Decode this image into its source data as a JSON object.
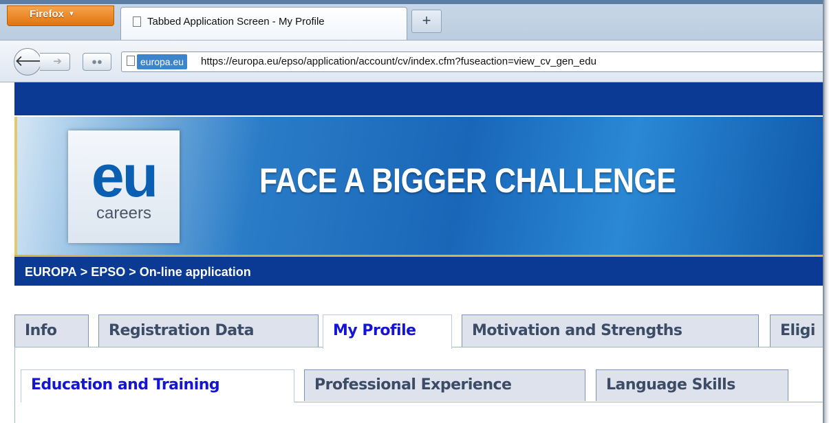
{
  "browser": {
    "menu_label": "Firefox",
    "tab_title": "Tabbed Application Screen - My Profile",
    "new_tab_label": "+",
    "site_badge": "europa.eu",
    "url": "https://europa.eu/epso/application/account/cv/index.cfm?fuseaction=view_cv_gen_edu",
    "icons": [
      "back-icon",
      "forward-icon",
      "identity-icon",
      "page-icon"
    ]
  },
  "banner": {
    "logo_main": "eu",
    "logo_sub": "careers",
    "slogan": "FACE A BIGGER CHALLENGE"
  },
  "breadcrumb": {
    "items": [
      "EUROPA",
      "EPSO",
      "On-line application"
    ],
    "separator": ">"
  },
  "main_tabs": [
    {
      "label": "Info",
      "active": false
    },
    {
      "label": "Registration Data",
      "active": false
    },
    {
      "label": "My Profile",
      "active": true
    },
    {
      "label": "Motivation and Strengths",
      "active": false
    },
    {
      "label": "Eligi",
      "active": false
    }
  ],
  "sub_tabs": [
    {
      "label": "Education and Training",
      "active": true
    },
    {
      "label": "Professional Experience",
      "active": false
    },
    {
      "label": "Language Skills",
      "active": false
    }
  ],
  "colors": {
    "site_blue": "#0a3a94",
    "active_tab_text": "#1414d6",
    "inactive_tab_text": "#3d4c66",
    "firefox_orange": "#e2740f"
  }
}
